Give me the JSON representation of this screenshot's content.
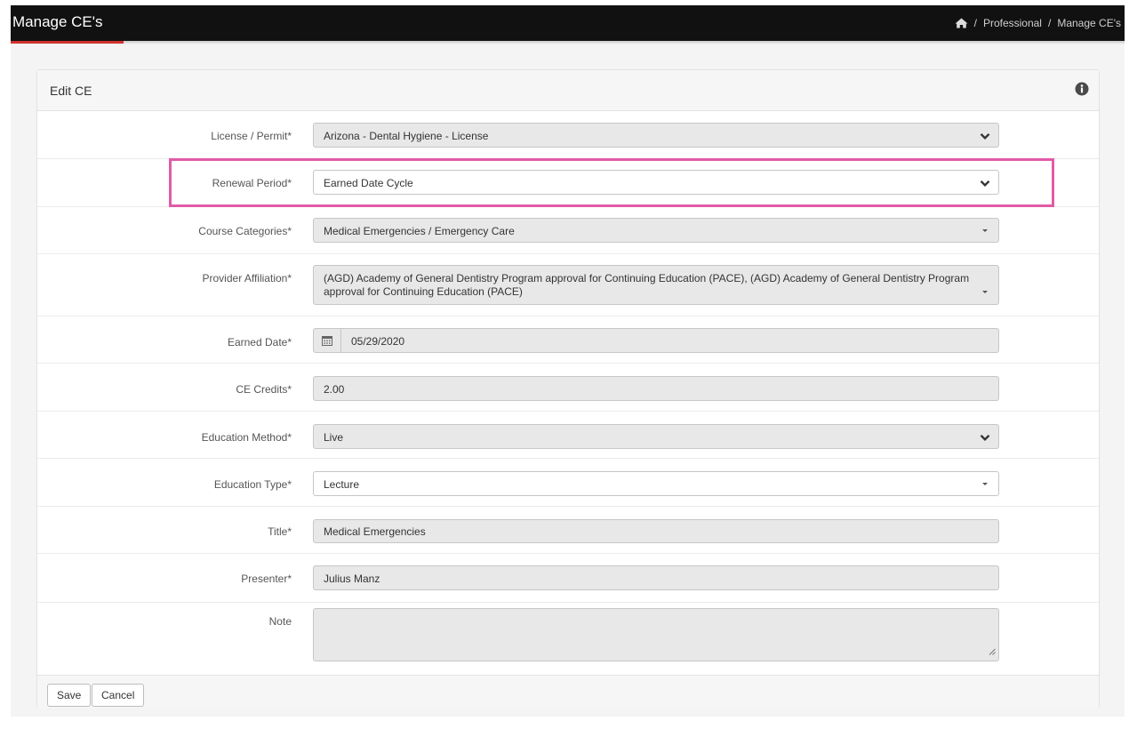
{
  "header": {
    "title": "Manage CE's",
    "breadcrumb": [
      "Professional",
      "Manage CE's"
    ],
    "separator": "/"
  },
  "panel": {
    "title": "Edit CE"
  },
  "form": {
    "license": {
      "label": "License / Permit*",
      "value": "Arizona - Dental Hygiene - License"
    },
    "renewal": {
      "label": "Renewal Period*",
      "value": "Earned Date Cycle"
    },
    "categories": {
      "label": "Course Categories*",
      "value": "Medical Emergencies / Emergency Care"
    },
    "affiliation": {
      "label": "Provider Affiliation*",
      "line1": "(AGD) Academy of General Dentistry Program approval for Continuing Education (PACE), (AGD) Academy of General Dentistry Program",
      "line2": "approval for Continuing Education (PACE)"
    },
    "earned_date": {
      "label": "Earned Date*",
      "value": "05/29/2020"
    },
    "credits": {
      "label": "CE Credits*",
      "value": "2.00"
    },
    "method": {
      "label": "Education Method*",
      "value": "Live"
    },
    "type": {
      "label": "Education Type*",
      "value": "Lecture"
    },
    "title": {
      "label": "Title*",
      "value": "Medical Emergencies"
    },
    "presenter": {
      "label": "Presenter*",
      "value": "Julius Manz"
    },
    "note": {
      "label": "Note",
      "value": ""
    }
  },
  "footer": {
    "save_label": "Save",
    "cancel_label": "Cancel"
  },
  "colors": {
    "topbar": "#111111",
    "accent_red": "#d0312d",
    "highlight_pink": "#e25aa8"
  },
  "icons": [
    "home-icon",
    "info-icon",
    "chevron-down-icon",
    "caret-down-icon",
    "calendar-icon",
    "resize-grip-icon"
  ]
}
